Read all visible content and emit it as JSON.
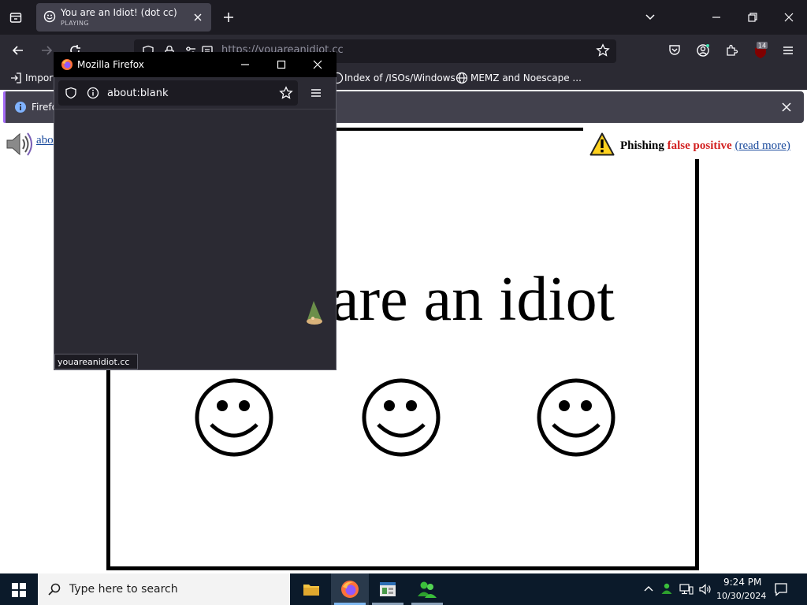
{
  "browser": {
    "tab": {
      "title": "You are an Idiot! (dot cc)",
      "status": "PLAYING"
    },
    "url": "https://youareanidiot.cc",
    "badge_count": "14",
    "bookmarks": [
      {
        "label": "Import"
      },
      {
        "label": "Index of /ISOs/Windows"
      },
      {
        "label": "MEMZ and Noescape ..."
      }
    ],
    "notification": {
      "text": "Firefox"
    }
  },
  "page": {
    "about_link": "abo",
    "big_text": "are an idiot",
    "warning": {
      "label": "Phishing",
      "highlight": "false positive",
      "link": "(read more)"
    }
  },
  "popup": {
    "title": "Mozilla Firefox",
    "url": "about:blank",
    "status": "youareanidiot.cc"
  },
  "taskbar": {
    "search_placeholder": "Type here to search",
    "time": "9:24 PM",
    "date": "10/30/2024"
  },
  "colors": {
    "tab_bg": "#1c1b22",
    "toolbar_bg": "#2b2a33",
    "active_tab": "#42414d",
    "warning_red": "#d21e1e",
    "link_blue": "#1a4a9c",
    "taskbar": "#0b1a2a"
  }
}
